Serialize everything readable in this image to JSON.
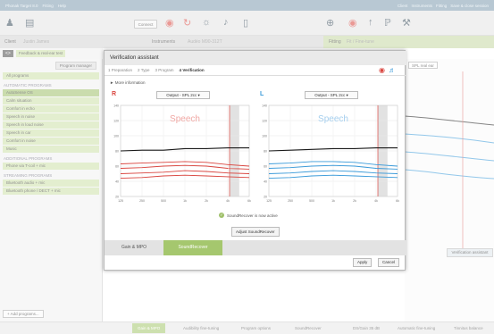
{
  "app": {
    "menu": [
      "Phonak Target 8.0",
      "Fitting",
      "Help"
    ],
    "right_items": [
      "Client",
      "Instruments",
      "Fitting",
      "Save & close session"
    ]
  },
  "toolbar": {
    "connect_label": "Connect"
  },
  "fitbar": {
    "client_label": "Client",
    "client_name": "Justin James",
    "instruments_label": "Instruments",
    "instruments_value": "Audéo M90-312T",
    "fitting_label": "Fitting",
    "fitting_value": "Fit / Fine-tune"
  },
  "nav": {
    "nav_label": "<>",
    "feedback_label": "Feedback & real-ear test"
  },
  "sidebar": {
    "program_manager": "Program manager",
    "all_programs": "All programs",
    "auto_header": "AUTOMATIC PROGRAMS",
    "auto_items": [
      "AutoSense OS",
      "Calm situation",
      "Comfort in echo",
      "Speech in noise",
      "Speech in loud noise",
      "Speech in car",
      "Comfort in noise",
      "Music"
    ],
    "additional_header": "ADDITIONAL PROGRAMS",
    "additional_items": [
      "Phone via T-coil + mic"
    ],
    "streaming_header": "STREAMING PROGRAMS",
    "streaming_items": [
      "Bluetooth audio + mic",
      "Bluetooth phone / DECT + mic"
    ],
    "add_programs": "+ Add programs..."
  },
  "rightpanel": {
    "spl_select": "SPL real ear",
    "verification_button": "Verification assistant"
  },
  "bottombar": {
    "tabs": [
      "Gain & MPO",
      "Audibility fine-tuning",
      "Program options",
      "SoundRecover",
      "DS/Gain 35 dB",
      "Automatic fine-tuning",
      "Tinnitus balance"
    ]
  },
  "modal": {
    "title": "Verification assistant",
    "steps": [
      {
        "num": "1",
        "label": "Preparation"
      },
      {
        "num": "2",
        "label": "Type"
      },
      {
        "num": "3",
        "label": "Program"
      },
      {
        "num": "4",
        "label": "Verification"
      }
    ],
    "more_info": "More information",
    "left_ear": "R",
    "right_ear": "L",
    "output_select_left": "Output - SPL 2cc",
    "output_select_right": "Output - SPL 2cc",
    "speech_label_left": "Speech",
    "speech_label_right": "Speech",
    "status_text": "SoundRecover is now active",
    "adjust_button": "Adjust SoundRecover",
    "tabs": [
      "Gain & MPO",
      "SoundRecover"
    ],
    "apply": "Apply",
    "cancel": "Cancel"
  },
  "chart_data": [
    {
      "type": "line",
      "title": "Speech",
      "xlabel": "",
      "ylabel": "",
      "x_ticks": [
        "125",
        "250",
        "500",
        "1k",
        "2k",
        "4k",
        "6k"
      ],
      "y_ticks": [
        "140",
        "120",
        "100",
        "80",
        "60",
        "40",
        "20"
      ],
      "ylim": [
        20,
        140
      ],
      "series": [
        {
          "color": "#1a1a1a",
          "values": [
            80,
            81,
            81,
            83,
            83,
            84,
            84
          ]
        },
        {
          "color": "#d9453f",
          "values": [
            63,
            64,
            65,
            66,
            65,
            62,
            60
          ]
        },
        {
          "color": "#d9453f",
          "values": [
            57,
            58,
            60,
            61,
            60,
            57,
            56
          ]
        },
        {
          "color": "#d9453f",
          "values": [
            50,
            51,
            52,
            54,
            53,
            51,
            50
          ]
        },
        {
          "color": "#d9453f",
          "values": [
            44,
            45,
            47,
            48,
            47,
            46,
            45
          ]
        }
      ]
    },
    {
      "type": "line",
      "title": "Speech",
      "xlabel": "",
      "ylabel": "",
      "x_ticks": [
        "125",
        "250",
        "500",
        "1k",
        "2k",
        "4k",
        "6k"
      ],
      "y_ticks": [
        "140",
        "120",
        "100",
        "80",
        "60",
        "40",
        "20"
      ],
      "ylim": [
        20,
        140
      ],
      "series": [
        {
          "color": "#1a1a1a",
          "values": [
            80,
            81,
            82,
            83,
            83,
            84,
            84
          ]
        },
        {
          "color": "#3a9ad9",
          "values": [
            63,
            64,
            66,
            66,
            65,
            62,
            60
          ]
        },
        {
          "color": "#3a9ad9",
          "values": [
            57,
            58,
            60,
            61,
            60,
            57,
            56
          ]
        },
        {
          "color": "#3a9ad9",
          "values": [
            50,
            51,
            53,
            54,
            53,
            51,
            50
          ]
        },
        {
          "color": "#3a9ad9",
          "values": [
            44,
            45,
            47,
            48,
            47,
            46,
            45
          ]
        }
      ]
    }
  ]
}
